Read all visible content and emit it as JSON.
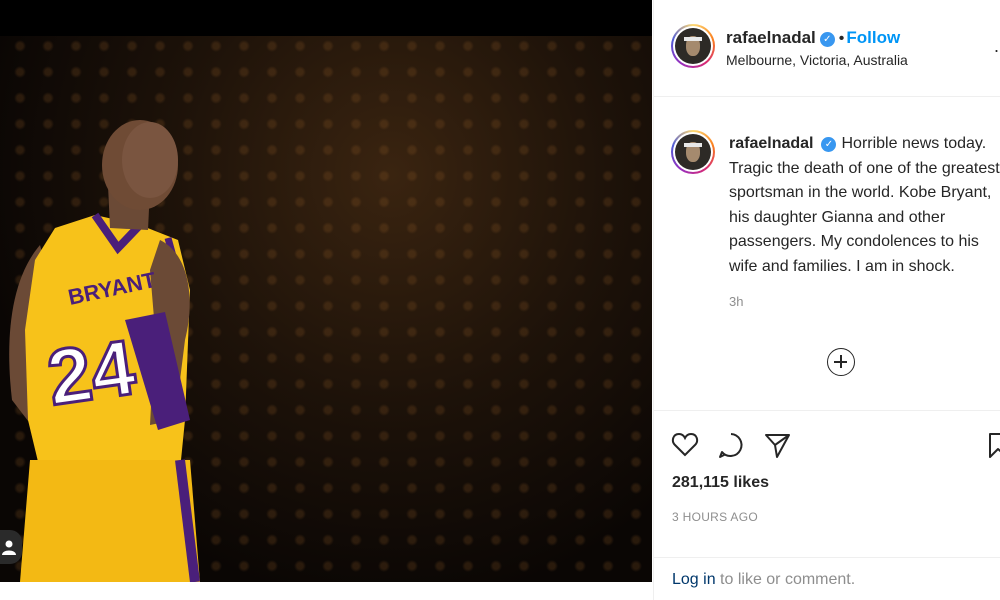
{
  "post": {
    "author": "rafaelnadal",
    "verified": true,
    "follow_label": "Follow",
    "dot": "•",
    "location": "Melbourne, Victoria, Australia",
    "more_label": "."
  },
  "photo": {
    "jersey_name": "BRYANT",
    "jersey_number": "24"
  },
  "caption": {
    "author": "rafaelnadal",
    "text": "Horrible news today. Tragic the death of one of the greatest sportsman in the world. Kobe Bryant, his daughter Gianna and other passengers. My condolences to his wife and families. I am in shock.",
    "time_ago": "3h"
  },
  "stats": {
    "likes": "281,115 likes",
    "posted": "3 HOURS AGO"
  },
  "footer": {
    "login_link": "Log in",
    "login_suffix": " to like or comment."
  },
  "colors": {
    "follow": "#0095f6",
    "verified": "#3897f0",
    "jersey": "#f7c21a",
    "purple": "#4a1f7a"
  },
  "icons": [
    "like-heart-icon",
    "comment-icon",
    "share-icon",
    "bookmark-icon",
    "add-comment-icon",
    "user-icon"
  ]
}
